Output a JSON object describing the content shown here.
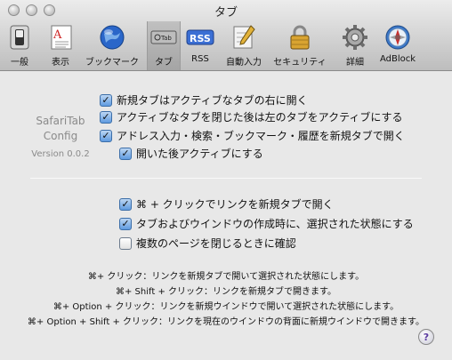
{
  "window": {
    "title": "タブ"
  },
  "toolbar": {
    "items": [
      {
        "label": "一般",
        "icon": "switch-icon"
      },
      {
        "label": "表示",
        "icon": "font-appearance-icon"
      },
      {
        "label": "ブックマーク",
        "icon": "globe-icon"
      },
      {
        "label": "タブ",
        "icon": "tabs-icon",
        "selected": true
      },
      {
        "label": "RSS",
        "icon": "rss-icon"
      },
      {
        "label": "自動入力",
        "icon": "autofill-pencil-icon"
      },
      {
        "label": "セキュリティ",
        "icon": "lock-icon"
      },
      {
        "label": "詳細",
        "icon": "gear-icon"
      },
      {
        "label": "AdBlock",
        "icon": "compass-icon"
      }
    ]
  },
  "app": {
    "title_line1": "SafariTab",
    "title_line2": "Config",
    "version": "Version 0.0.2"
  },
  "options": [
    {
      "label": "新規タブはアクティブなタブの右に開く",
      "checked": true
    },
    {
      "label": "アクティブなタブを閉じた後は左のタブをアクティブにする",
      "checked": true
    },
    {
      "label": "アドレス入力・検索・ブックマーク・履歴を新規タブで開く",
      "checked": true
    },
    {
      "label": "開いた後アクティブにする",
      "checked": true
    },
    {
      "label": "⌘ + クリックでリンクを新規タブで開く",
      "checked": true
    },
    {
      "label": "タブおよびウインドウの作成時に、選択された状態にする",
      "checked": true
    },
    {
      "label": "複数のページを閉じるときに確認",
      "checked": false
    }
  ],
  "shortcuts": [
    "⌘+ クリック：リンクを新規タブで開いて選択された状態にします。",
    "⌘+ Shift + クリック：リンクを新規タブで開きます。",
    "⌘+ Option + クリック：リンクを新規ウインドウで開いて選択された状態にします。",
    "⌘+ Option + Shift + クリック：リンクを現在のウインドウの背面に新規ウインドウで開きます。"
  ],
  "help": {
    "label": "?"
  },
  "colors": {
    "checkbox_blue": "#5f9be0",
    "rss_blue": "#3b6fd4",
    "help_purple": "#5a3aa0"
  }
}
